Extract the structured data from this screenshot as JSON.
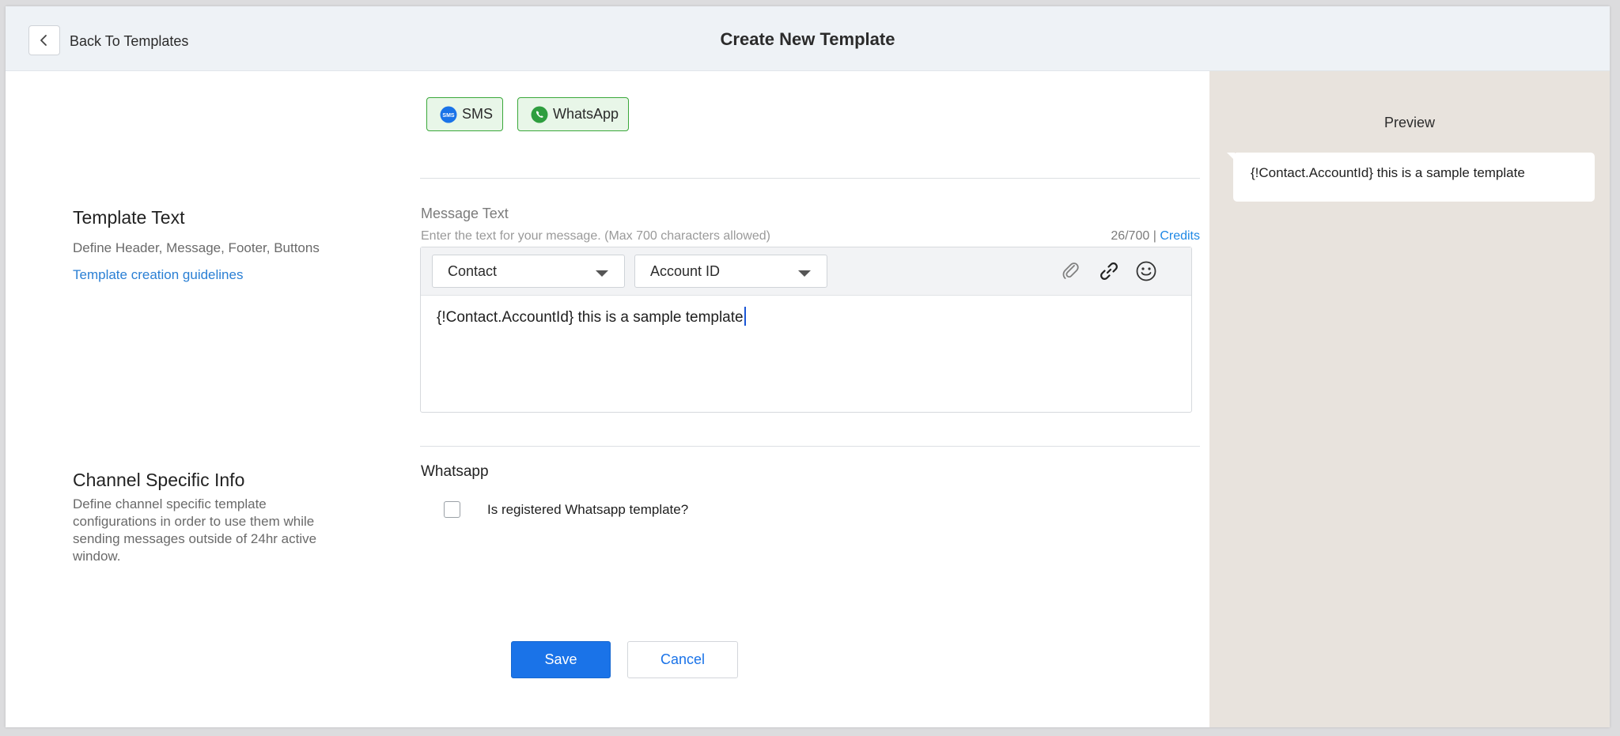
{
  "header": {
    "back_label": "Back To Templates",
    "title": "Create New Template"
  },
  "channels": [
    {
      "label": "SMS",
      "icon": "sms-icon"
    },
    {
      "label": "WhatsApp",
      "icon": "whatsapp-icon"
    }
  ],
  "template_text": {
    "title": "Template Text",
    "description": "Define Header, Message, Footer, Buttons",
    "guidelines_link": "Template creation guidelines"
  },
  "message": {
    "label": "Message Text",
    "hint": "Enter the text for your message. (Max 700 characters allowed)",
    "count": "26/700",
    "separator": "|",
    "credits_label": "Credits",
    "object_select": "Contact",
    "field_select": "Account ID",
    "body": "{!Contact.AccountId} this is a sample template"
  },
  "channel_info": {
    "title": "Channel Specific Info",
    "description": "Define channel specific template configurations in order to use them while sending messages outside of 24hr active window.",
    "whatsapp_title": "Whatsapp",
    "checkbox_label": "Is registered Whatsapp template?",
    "checkbox_checked": false
  },
  "actions": {
    "save_label": "Save",
    "cancel_label": "Cancel"
  },
  "preview": {
    "title": "Preview",
    "bubble_text": "{!Contact.AccountId} this is a sample template"
  },
  "colors": {
    "accent": "#1a73e8",
    "link": "#2a7fd4",
    "whatsapp_green": "#3aa83a",
    "preview_bg": "#e8e3dd"
  }
}
